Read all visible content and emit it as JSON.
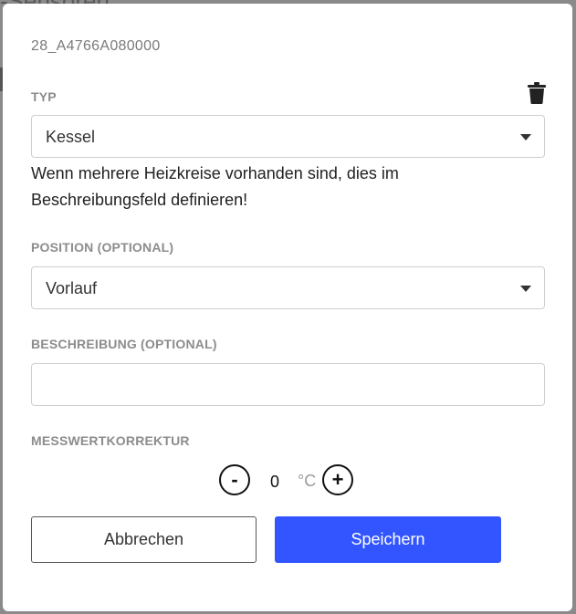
{
  "backdrop": {
    "title_fragment": "-Sensoren"
  },
  "dialog": {
    "sensor_id": "28_A4766A080000",
    "type_field": {
      "label": "TYP",
      "selected": "Kessel"
    },
    "hint": "Wenn mehrere Heizkreise vorhanden sind, dies im Beschreibungsfeld definieren!",
    "position_field": {
      "label": "POSITION (OPTIONAL)",
      "selected": "Vorlauf"
    },
    "description_field": {
      "label": "BESCHREIBUNG (OPTIONAL)",
      "value": "",
      "placeholder": ""
    },
    "correction": {
      "label": "MESSWERTKORREKTUR",
      "value": "0",
      "unit": "°C",
      "decrement_glyph": "-",
      "increment_glyph": "+"
    },
    "actions": {
      "cancel_label": "Abbrechen",
      "save_label": "Speichern"
    }
  },
  "colors": {
    "primary": "#3355ff",
    "label": "#8c8c8c",
    "border": "#cfcfcf",
    "overlay": "#8a8a8a"
  },
  "icons": {
    "delete": "trash-icon",
    "dropdown": "caret-down-icon"
  }
}
